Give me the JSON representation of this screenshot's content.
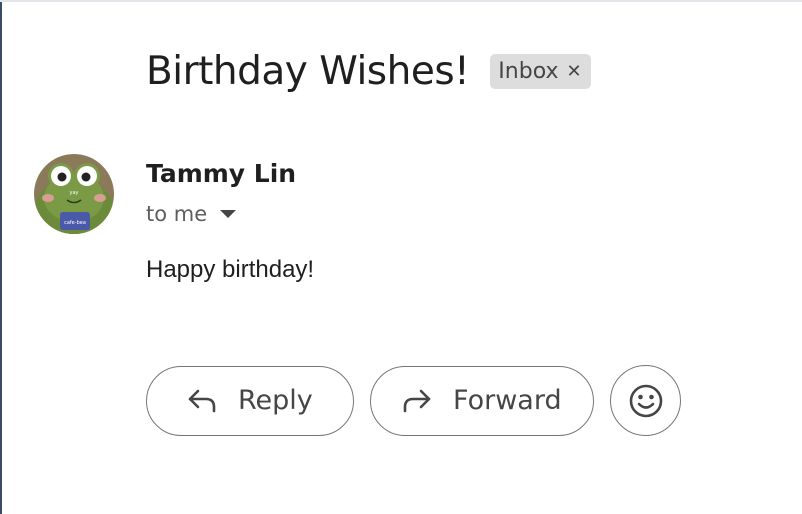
{
  "email": {
    "subject": "Birthday Wishes!",
    "label_chip": "Inbox",
    "label_close_icon": "close-icon",
    "sender_name": "Tammy Lin",
    "recipient": "to me",
    "recipient_toggle_icon": "caret-down-icon",
    "body": "Happy birthday!",
    "avatar": {
      "icon": "frog-avatar",
      "text_top": "yay",
      "text_mug": "cafe-bea"
    }
  },
  "actions": {
    "reply_label": "Reply",
    "reply_icon": "reply-arrow-icon",
    "forward_label": "Forward",
    "forward_icon": "forward-arrow-icon",
    "emoji_icon": "smiley-face-icon"
  },
  "colors": {
    "text_primary": "#1f1f1f",
    "text_secondary": "#444746",
    "chip_background": "#dddddd",
    "button_border": "#747775",
    "avatar_green": "#6b8a3a"
  }
}
